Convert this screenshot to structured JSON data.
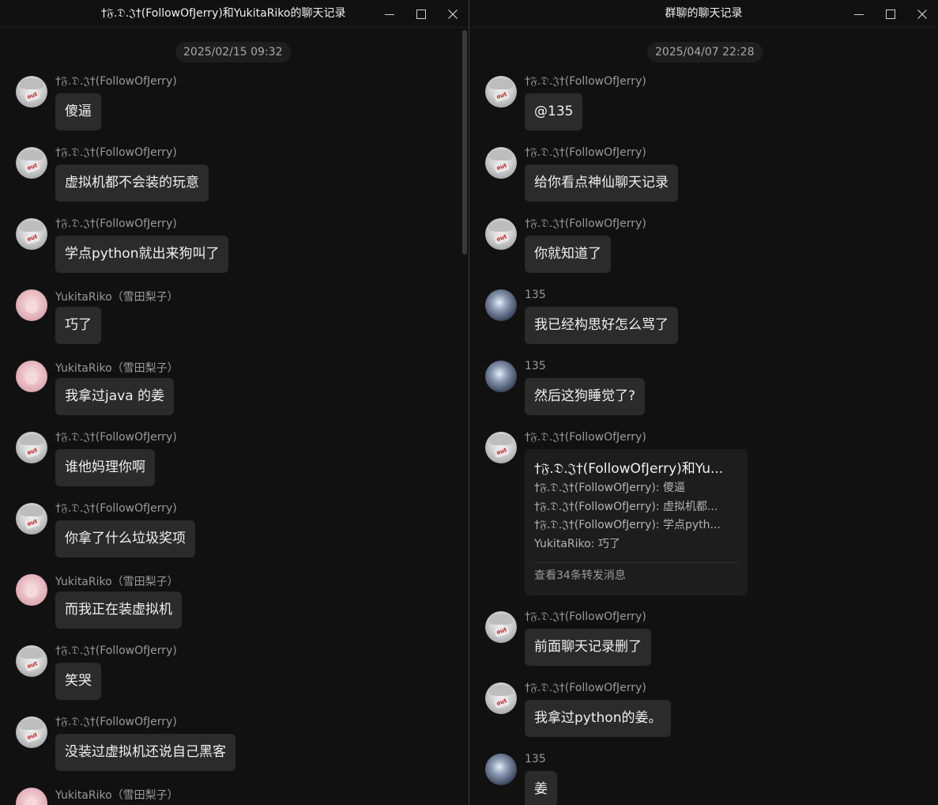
{
  "colors": {
    "background": "#111111",
    "bubble": "#2b2b2b",
    "forward_card": "#1d1d1d",
    "name_text": "#9a9a9a",
    "date_badge": "#1e1e1e"
  },
  "icons": [
    "minimize-icon",
    "maximize-icon",
    "close-icon"
  ],
  "left_window": {
    "title": "†𝔉.𝔇.𝔍†(FollowOfJerry)和YukitaRiko的聊天记录",
    "date": "2025/02/15 09:32",
    "messages": [
      {
        "avatar": "jerry",
        "sender": "†𝔉.𝔇.𝔍†(FollowOfJerry)",
        "text": "傻逼"
      },
      {
        "avatar": "jerry",
        "sender": "†𝔉.𝔇.𝔍†(FollowOfJerry)",
        "text": "虚拟机都不会装的玩意"
      },
      {
        "avatar": "jerry",
        "sender": "†𝔉.𝔇.𝔍†(FollowOfJerry)",
        "text": "学点python就出来狗叫了"
      },
      {
        "avatar": "riko",
        "sender": "YukitaRiko（雪田梨子）",
        "text": "巧了"
      },
      {
        "avatar": "riko",
        "sender": "YukitaRiko（雪田梨子）",
        "text": "我拿过java 的姜"
      },
      {
        "avatar": "jerry",
        "sender": "†𝔉.𝔇.𝔍†(FollowOfJerry)",
        "text": "谁他妈理你啊"
      },
      {
        "avatar": "jerry",
        "sender": "†𝔉.𝔇.𝔍†(FollowOfJerry)",
        "text": "你拿了什么垃圾奖项"
      },
      {
        "avatar": "riko",
        "sender": "YukitaRiko（雪田梨子）",
        "text": "而我正在装虚拟机"
      },
      {
        "avatar": "jerry",
        "sender": "†𝔉.𝔇.𝔍†(FollowOfJerry)",
        "text": "笑哭"
      },
      {
        "avatar": "jerry",
        "sender": "†𝔉.𝔇.𝔍†(FollowOfJerry)",
        "text": "没装过虚拟机还说自己黑客"
      },
      {
        "avatar": "riko",
        "sender": "YukitaRiko（雪田梨子）",
        "text": ""
      }
    ]
  },
  "right_window": {
    "title": "群聊的聊天记录",
    "date": "2025/04/07 22:28",
    "messages": [
      {
        "avatar": "jerry",
        "sender": "†𝔉.𝔇.𝔍†(FollowOfJerry)",
        "text": "@135"
      },
      {
        "avatar": "jerry",
        "sender": "†𝔉.𝔇.𝔍†(FollowOfJerry)",
        "text": "给你看点神仙聊天记录"
      },
      {
        "avatar": "jerry",
        "sender": "†𝔉.𝔇.𝔍†(FollowOfJerry)",
        "text": "你就知道了"
      },
      {
        "avatar": "n135",
        "sender": "135",
        "text": "我已经构思好怎么骂了"
      },
      {
        "avatar": "n135",
        "sender": "135",
        "text": "然后这狗睡觉了?"
      },
      {
        "avatar": "jerry",
        "sender": "†𝔉.𝔇.𝔍†(FollowOfJerry)",
        "forward": {
          "title": "†𝔉.𝔇.𝔍†(FollowOfJerry)和Yu...",
          "lines": [
            "†𝔉.𝔇.𝔍†(FollowOfJerry): 傻逼",
            "†𝔉.𝔇.𝔍†(FollowOfJerry): 虚拟机都...",
            "†𝔉.𝔇.𝔍†(FollowOfJerry): 学点pyth...",
            "YukitaRiko: 巧了"
          ],
          "footer": "查看34条转发消息"
        }
      },
      {
        "avatar": "jerry",
        "sender": "†𝔉.𝔇.𝔍†(FollowOfJerry)",
        "text": "前面聊天记录删了"
      },
      {
        "avatar": "jerry",
        "sender": "†𝔉.𝔇.𝔍†(FollowOfJerry)",
        "text": "我拿过python的姜。"
      },
      {
        "avatar": "n135",
        "sender": "135",
        "text": "姜"
      }
    ]
  }
}
